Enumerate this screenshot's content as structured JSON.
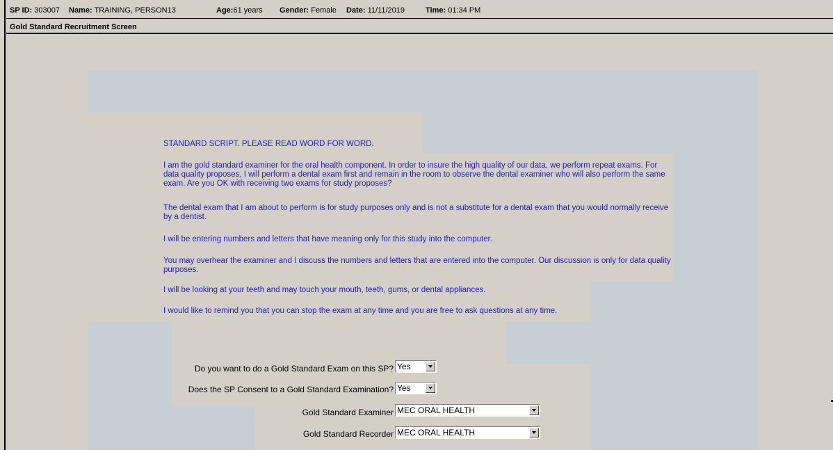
{
  "header": {
    "sp_id_label": "SP ID:",
    "sp_id": "303007",
    "name_label": "Name:",
    "name": "TRAINING, PERSON13",
    "age_label": "Age:",
    "age": "61 years",
    "gender_label": "Gender:",
    "gender": "Female",
    "date_label": "Date:",
    "date": "11/11/2019",
    "time_label": "Time:",
    "time": "01:34 PM"
  },
  "screen_title": "Gold Standard Recruitment Screen",
  "script": {
    "heading": "STANDARD SCRIPT. PLEASE READ WORD FOR WORD.",
    "p1": "I am the gold standard examiner for the oral health component. In order to insure the high quality of our data, we perform repeat exams. For data quality proposes, I will perform a dental exam first and remain in the room to observe the dental examiner who will also perform the same exam. Are you OK with receiving two exams for study proposes?",
    "p2": "The dental exam that I am about to perform is for study purposes only and is not a substitute for a dental exam that you would normally receive by a dentist.",
    "p3": "I will be entering numbers and letters that have meaning only for this study into the computer.",
    "p4": "You may overhear the examiner and I discuss the numbers and letters that are entered into the computer. Our discussion is only for data quality purposes.",
    "p5": "I will be looking at your teeth and may touch your mouth, teeth, gums, or dental appliances.",
    "p6": "I would like to remind you that you can stop the exam at any time and you are free to ask questions at any time."
  },
  "form": {
    "q1_label": "Do you want to do a Gold Standard Exam on this SP?",
    "q1_value": "Yes",
    "q2_label": "Does the SP Consent to a Gold Standard Examination?",
    "q2_value": "Yes",
    "examiner_label": "Gold Standard Examiner",
    "examiner_value": "MEC ORAL HEALTH",
    "recorder_label": "Gold Standard Recorder",
    "recorder_value": "MEC ORAL HEALTH"
  },
  "colors": {
    "background": "#d4d0c8",
    "panel_blue": "#c7cfd4",
    "script_text": "#1e1ec8"
  }
}
